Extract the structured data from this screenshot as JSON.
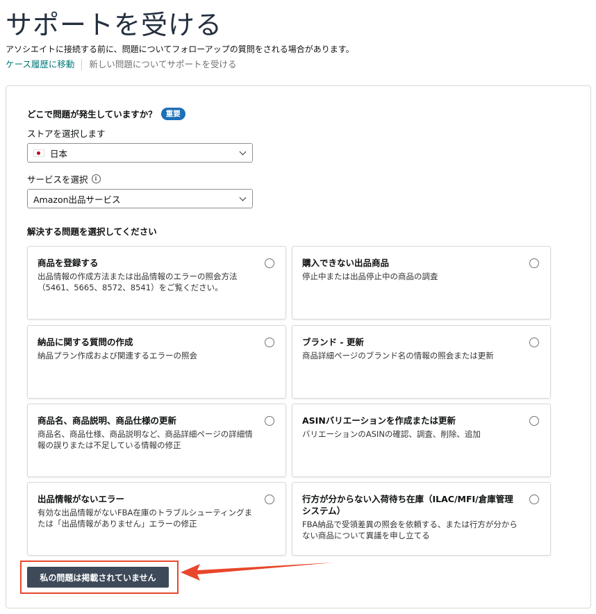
{
  "header": {
    "title": "サポートを受ける",
    "subtitle": "アソシエイトに接続する前に、問題についてフォローアップの質問をされる場合があります。",
    "link_case_history": "ケース履歴に移動",
    "link_new_issue": "新しい問題についてサポートを受ける"
  },
  "form": {
    "question": "どこで問題が発生していますか？",
    "badge": "重要",
    "store_label": "ストアを選択します",
    "store_value": "日本",
    "service_label": "サービスを選択",
    "service_value": "Amazon出品サービス",
    "issue_label": "解決する問題を選択してください"
  },
  "cards": [
    {
      "title": "商品を登録する",
      "desc": "出品情報の作成方法または出品情報のエラーの照会方法（5461、5665、8572、8541）をご覧ください。"
    },
    {
      "title": "購入できない出品商品",
      "desc": "停止中または出品停止中の商品の調査"
    },
    {
      "title": "納品に関する質問の作成",
      "desc": "納品プラン作成および関連するエラーの照会"
    },
    {
      "title": "ブランド - 更新",
      "desc": "商品詳細ページのブランド名の情報の照会または更新"
    },
    {
      "title": "商品名、商品説明、商品仕様の更新",
      "desc": "商品名、商品仕様、商品説明など、商品詳細ページの詳細情報の誤りまたは不足している情報の修正"
    },
    {
      "title": "ASINバリエーションを作成または更新",
      "desc": "バリエーションのASINの確認、調査、削除、追加"
    },
    {
      "title": "出品情報がないエラー",
      "desc": "有効な出品情報がないFBA在庫のトラブルシューティングまたは「出品情報がありません」エラーの修正"
    },
    {
      "title": "行方が分からない入荷待ち在庫（ILAC/MFI/倉庫管理システム）",
      "desc": "FBA納品で受領差異の照会を依頼する、または行方が分からない商品について異議を申し立てる"
    }
  ],
  "buttons": {
    "not_listed": "私の問題は掲載されていません"
  },
  "colors": {
    "accent_link": "#00787a",
    "badge": "#1d6fb8",
    "button": "#3e4a5a",
    "annotation": "#e8472b"
  }
}
